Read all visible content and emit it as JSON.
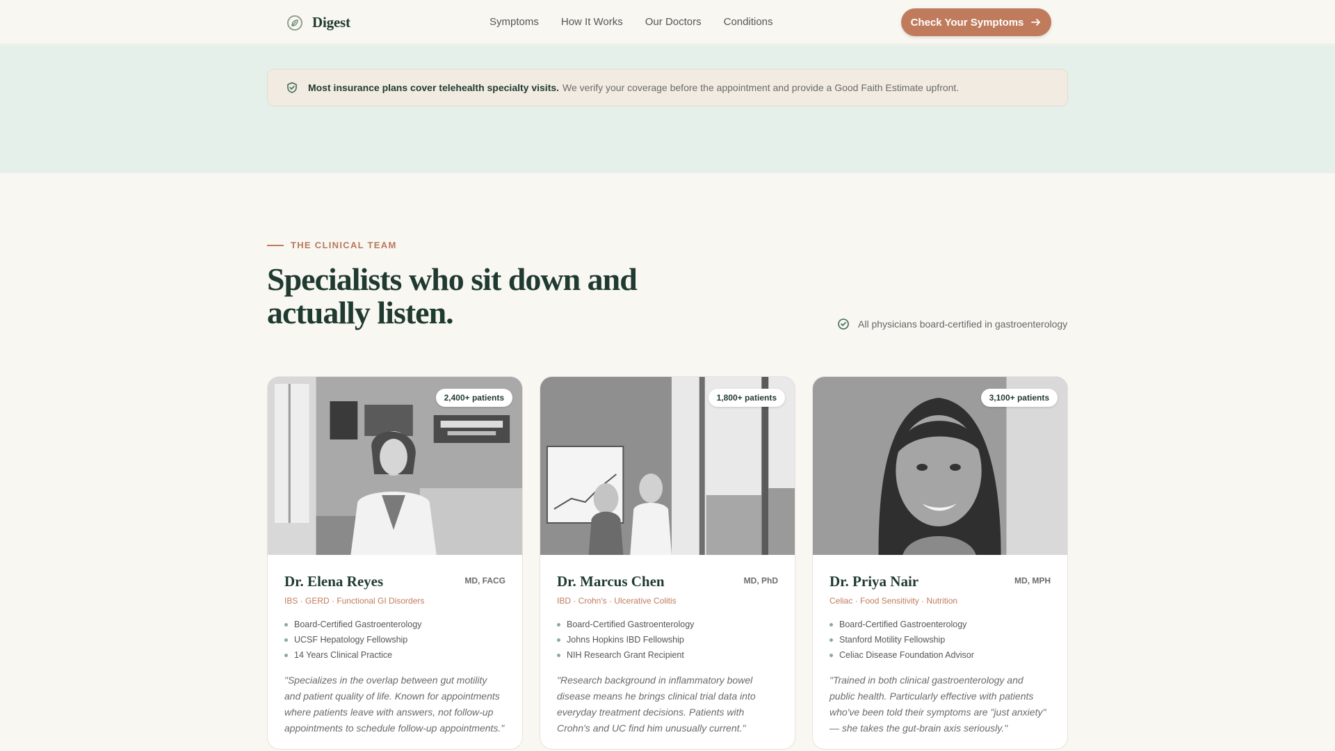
{
  "nav": {
    "brand": "Digest",
    "links": [
      "Symptoms",
      "How It Works",
      "Our Doctors",
      "Conditions"
    ],
    "cta": "Check Your Symptoms"
  },
  "notice": {
    "bold": "Most insurance plans cover telehealth specialty visits.",
    "text": "We verify your coverage before the appointment and provide a Good Faith Estimate upfront."
  },
  "section": {
    "eyebrow": "THE CLINICAL TEAM",
    "heading": "Specialists who sit down and actually listen.",
    "board_note": "All physicians board-certified in gastroenterology"
  },
  "doctors": [
    {
      "patients": "2,400+ patients",
      "name": "Dr. Elena Reyes",
      "credentials": "MD, FACG",
      "specialties": "IBS · GERD · Functional GI Disorders",
      "qualifications": [
        "Board-Certified Gastroenterology",
        "UCSF Hepatology Fellowship",
        "14 Years Clinical Practice"
      ],
      "quote": "\"Specializes in the overlap between gut motility and patient quality of life. Known for appointments where patients leave with answers, not follow-up appointments to schedule follow-up appointments.\""
    },
    {
      "patients": "1,800+ patients",
      "name": "Dr. Marcus Chen",
      "credentials": "MD, PhD",
      "specialties": "IBD · Crohn's · Ulcerative Colitis",
      "qualifications": [
        "Board-Certified Gastroenterology",
        "Johns Hopkins IBD Fellowship",
        "NIH Research Grant Recipient"
      ],
      "quote": "\"Research background in inflammatory bowel disease means he brings clinical trial data into everyday treatment decisions. Patients with Crohn's and UC find him unusually current.\""
    },
    {
      "patients": "3,100+ patients",
      "name": "Dr. Priya Nair",
      "credentials": "MD, MPH",
      "specialties": "Celiac · Food Sensitivity · Nutrition",
      "qualifications": [
        "Board-Certified Gastroenterology",
        "Stanford Motility Fellowship",
        "Celiac Disease Foundation Advisor"
      ],
      "quote": "\"Trained in both clinical gastroenterology and public health. Particularly effective with patients who've been told their symptoms are \"just anxiety\" — she takes the gut-brain axis seriously.\""
    }
  ],
  "colors": {
    "accent": "#c07b5c",
    "heading": "#1f3a30",
    "band": "#e6f0ea"
  },
  "icons": {
    "brand": "leaf-logo-icon",
    "cta": "arrow-right-icon",
    "notice": "shield-check-icon",
    "board": "check-circle-icon"
  }
}
